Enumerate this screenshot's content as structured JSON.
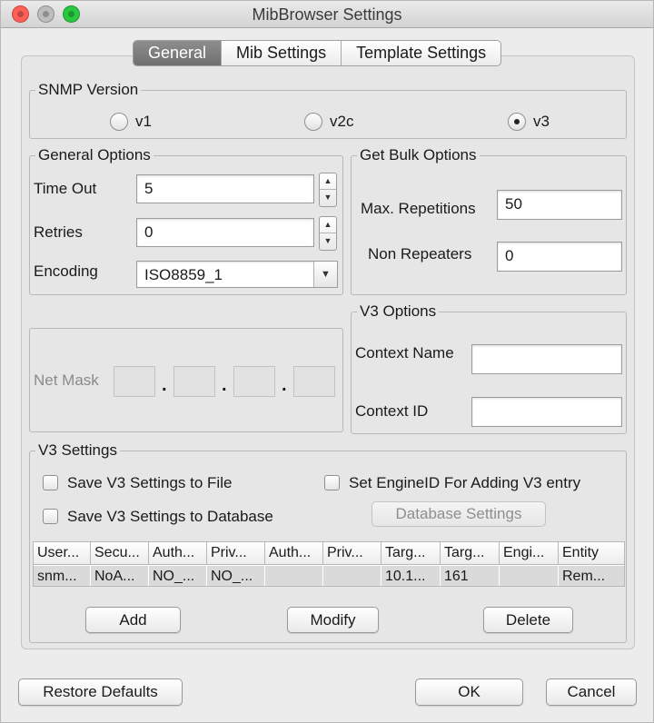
{
  "window": {
    "title": "MibBrowser Settings"
  },
  "tabs": [
    {
      "label": "General"
    },
    {
      "label": "Mib Settings"
    },
    {
      "label": "Template Settings"
    }
  ],
  "snmp_version": {
    "legend": "SNMP Version",
    "options": [
      {
        "label": "v1",
        "selected": false
      },
      {
        "label": "v2c",
        "selected": false
      },
      {
        "label": "v3",
        "selected": true
      }
    ]
  },
  "general_options": {
    "legend": "General Options",
    "timeout_label": "Time Out",
    "timeout_value": "5",
    "retries_label": "Retries",
    "retries_value": "0",
    "encoding_label": "Encoding",
    "encoding_value": "ISO8859_1"
  },
  "get_bulk_options": {
    "legend": "Get Bulk Options",
    "max_repetitions_label": "Max. Repetitions",
    "max_repetitions_value": "50",
    "non_repeaters_label": "Non Repeaters",
    "non_repeaters_value": "0"
  },
  "net_mask": {
    "label": "Net Mask",
    "dots": [
      ".",
      ".",
      "."
    ]
  },
  "v3_options": {
    "legend": "V3 Options",
    "context_name_label": "Context Name",
    "context_name_value": "",
    "context_id_label": "Context ID",
    "context_id_value": ""
  },
  "v3_settings": {
    "legend": "V3 Settings",
    "save_to_file_label": "Save V3 Settings to File",
    "save_to_database_label": "Save V3 Settings to Database",
    "set_engine_id_label": "Set EngineID For Adding V3 entry",
    "database_settings_label": "Database Settings",
    "table": {
      "columns": [
        "User...",
        "Secu...",
        "Auth...",
        "Priv...",
        "Auth...",
        "Priv...",
        "Targ...",
        "Targ...",
        "Engi...",
        "Entity"
      ],
      "rows": [
        [
          "snm...",
          "NoA...",
          "NO_...",
          "NO_...",
          "",
          "",
          "10.1...",
          "161",
          "",
          "Rem..."
        ]
      ]
    },
    "add_label": "Add",
    "modify_label": "Modify",
    "delete_label": "Delete"
  },
  "footer": {
    "restore_defaults_label": "Restore Defaults",
    "ok_label": "OK",
    "cancel_label": "Cancel"
  },
  "colors": {
    "active_tab": "#7f7f7f",
    "window_background": "#ececec",
    "selected_row": "#dadada"
  }
}
